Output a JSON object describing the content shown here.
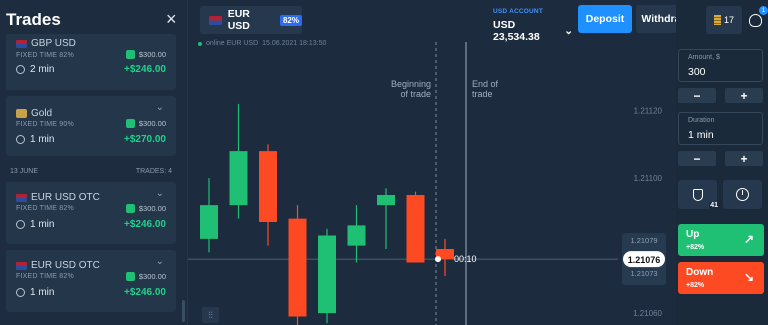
{
  "trades_panel": {
    "title": "Trades",
    "close_icon": "×",
    "cards": [
      {
        "asset": "GBP USD",
        "icon": "us-flag",
        "fixed_time": "FIXED TIME 82%",
        "stake": "$300.00",
        "duration": "2 min",
        "profit": "+$246.00"
      },
      {
        "asset": "Gold",
        "icon": "gold-icon",
        "fixed_time": "FIXED TIME 90%",
        "stake": "$300.00",
        "duration": "1 min",
        "profit": "+$270.00"
      },
      {
        "asset": "EUR USD OTC",
        "icon": "us-flag",
        "fixed_time": "FIXED TIME 82%",
        "stake": "$300.00",
        "duration": "1 min",
        "profit": "+$246.00"
      },
      {
        "asset": "EUR USD OTC",
        "icon": "us-flag",
        "fixed_time": "FIXED TIME 82%",
        "stake": "$300.00",
        "duration": "1 min",
        "profit": "+$246.00"
      }
    ],
    "day_label": "13 JUNE",
    "trades_count": "TRADES: 4",
    "chevron": "⌄"
  },
  "header": {
    "pair": "EUR USD",
    "pair_percent": "82%",
    "account_label": "USD ACCOUNT",
    "account_balance": "USD 23,534.38",
    "account_chevron": "⌄",
    "deposit_label": "Deposit",
    "withdraw_label": "Withdraw",
    "notifications_count": "17",
    "user_badge": "1"
  },
  "chart_meta": {
    "status": "online EUR USD",
    "timestamp": "15.06.2021 18:13:50"
  },
  "chart_data": {
    "type": "candlestick",
    "price_ticks": [
      "1.21120",
      "1.21100",
      "1.21079",
      "1.21073",
      "1.21060"
    ],
    "current_price": "1.21076",
    "countdown": "00:10",
    "begin_label_line1": "Beginning",
    "begin_label_line2": "of trade",
    "end_label_line1": "End of",
    "end_label_line2": "trade",
    "ylim": [
      1.21055,
      1.21135
    ],
    "candles": [
      {
        "open": 1.21082,
        "close": 1.21092,
        "high": 1.211,
        "low": 1.21078,
        "dir": "up"
      },
      {
        "open": 1.21092,
        "close": 1.21108,
        "high": 1.21122,
        "low": 1.21088,
        "dir": "up"
      },
      {
        "open": 1.21108,
        "close": 1.21087,
        "high": 1.2111,
        "low": 1.2108,
        "dir": "down"
      },
      {
        "open": 1.21088,
        "close": 1.21059,
        "high": 1.21092,
        "low": 1.21054,
        "dir": "down"
      },
      {
        "open": 1.2106,
        "close": 1.21083,
        "high": 1.21085,
        "low": 1.21057,
        "dir": "up"
      },
      {
        "open": 1.2108,
        "close": 1.21086,
        "high": 1.21092,
        "low": 1.21075,
        "dir": "up"
      },
      {
        "open": 1.21092,
        "close": 1.21095,
        "high": 1.21097,
        "low": 1.21079,
        "dir": "up"
      },
      {
        "open": 1.21095,
        "close": 1.21075,
        "high": 1.21096,
        "low": 1.21075,
        "dir": "down"
      },
      {
        "open": 1.21079,
        "close": 1.21076,
        "high": 1.21082,
        "low": 1.21071,
        "dir": "down"
      }
    ],
    "colors": {
      "up": "#1fbf74",
      "down": "#fe4a23"
    }
  },
  "controls": {
    "amount_label": "Amount, $",
    "amount_value": "300",
    "duration_label": "Duration",
    "duration_value": "1 min",
    "minus": "−",
    "plus": "+",
    "shield_count": "41",
    "up_label": "Up",
    "up_percent": "+82%",
    "up_arrow": "↗",
    "down_label": "Down",
    "down_percent": "+82%",
    "down_arrow": "↘",
    "up_color": "#1fbf74",
    "down_color": "#fe4a23"
  },
  "timeframe_icon": "candles-icon"
}
